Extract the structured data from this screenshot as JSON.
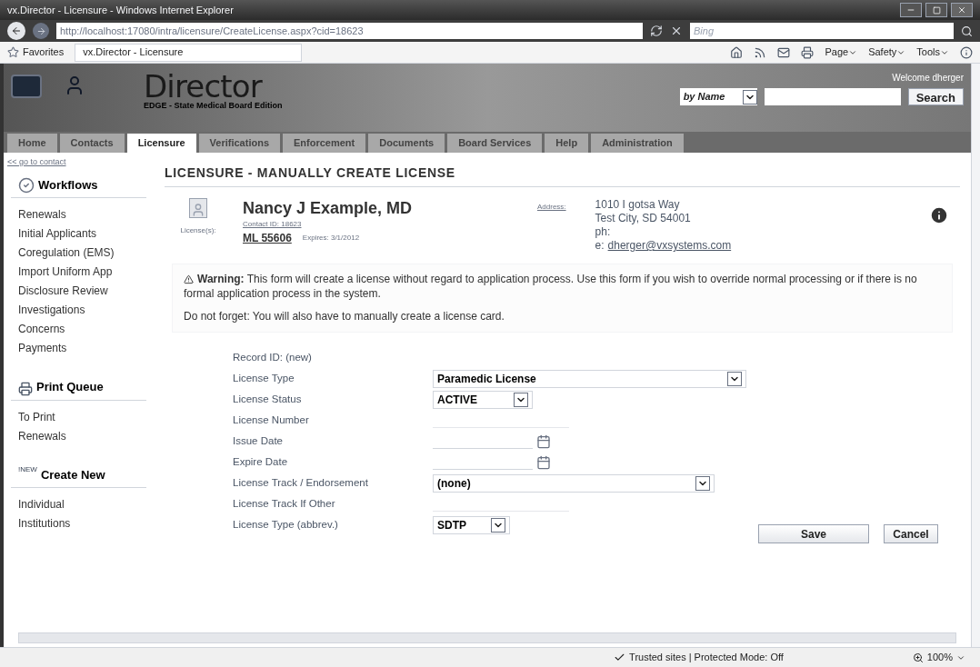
{
  "window": {
    "title": "vx.Director - Licensure - Windows Internet Explorer"
  },
  "browser": {
    "url": "http://localhost:17080/intra/licensure/CreateLicense.aspx?cid=18623",
    "search_placeholder": "Bing",
    "favorites": "Favorites",
    "tab": "vx.Director - Licensure",
    "commands": [
      "Page",
      "Safety",
      "Tools"
    ]
  },
  "header": {
    "app_name": "Director",
    "edition": "EDGE - State Medical Board Edition",
    "welcome": "Welcome dherger",
    "search_mode": "by Name",
    "search_button": "Search"
  },
  "nav_tabs": [
    {
      "label": "Home",
      "selected": false
    },
    {
      "label": "Contacts",
      "selected": false
    },
    {
      "label": "Licensure",
      "selected": true
    },
    {
      "label": "Verifications",
      "selected": false
    },
    {
      "label": "Enforcement",
      "selected": false
    },
    {
      "label": "Documents",
      "selected": false
    },
    {
      "label": "Board Services",
      "selected": false
    },
    {
      "label": "Help",
      "selected": false
    },
    {
      "label": "Administration",
      "selected": false
    }
  ],
  "sidebar": {
    "back_link": "<< go to contact",
    "sections": [
      {
        "kind": "workflows",
        "title": "Workflows",
        "items": [
          "Renewals",
          "Initial Applicants",
          "Coregulation (EMS)",
          "Import Uniform App",
          "Disclosure Review",
          "Investigations",
          "Concerns",
          "Payments"
        ]
      },
      {
        "kind": "print",
        "title": "Print Queue",
        "items": [
          "To Print",
          "Renewals"
        ]
      },
      {
        "kind": "new",
        "badge": "!NEW",
        "title": "Create New",
        "items": [
          "Individual",
          "Institutions"
        ]
      }
    ]
  },
  "page_title": "LICENSURE - MANUALLY CREATE LICENSE",
  "contact": {
    "name": "Nancy J Example, MD",
    "contact_id": "Contact ID: 18623",
    "licenses_label": "License(s):",
    "license": "ML 55606",
    "expires": "Expires: 3/1/2012",
    "address_label": "Address:",
    "address_lines": [
      "1010 I gotsa Way",
      "Test City, SD 54001",
      "ph:"
    ],
    "email_prefix": "e:",
    "email": "dherger@vxsystems.com"
  },
  "warning": {
    "label": "Warning:",
    "text": "This form will create a license without regard to application process. Use this form if you wish to override normal processing or if there is no formal application process in the system.",
    "note": "Do not forget: You will also have to manually create a license card."
  },
  "form": [
    {
      "kind": "static",
      "label": "Record ID: (new)"
    },
    {
      "kind": "select",
      "label": "License Type",
      "value": "Paramedic License"
    },
    {
      "kind": "select",
      "label": "License Status",
      "value": "ACTIVE"
    },
    {
      "kind": "text",
      "label": "License Number"
    },
    {
      "kind": "date",
      "label": "Issue Date"
    },
    {
      "kind": "date",
      "label": "Expire Date"
    },
    {
      "kind": "select",
      "label": "License Track / Endorsement",
      "value": "(none)"
    },
    {
      "kind": "text",
      "label": "License Track If Other"
    },
    {
      "kind": "select",
      "label": "License Type (abbrev.)",
      "value": "SDTP"
    }
  ],
  "buttons": [
    "Save",
    "Cancel"
  ],
  "status_bar": {
    "text": "Trusted sites | Protected Mode: Off",
    "zoom": "100%"
  }
}
